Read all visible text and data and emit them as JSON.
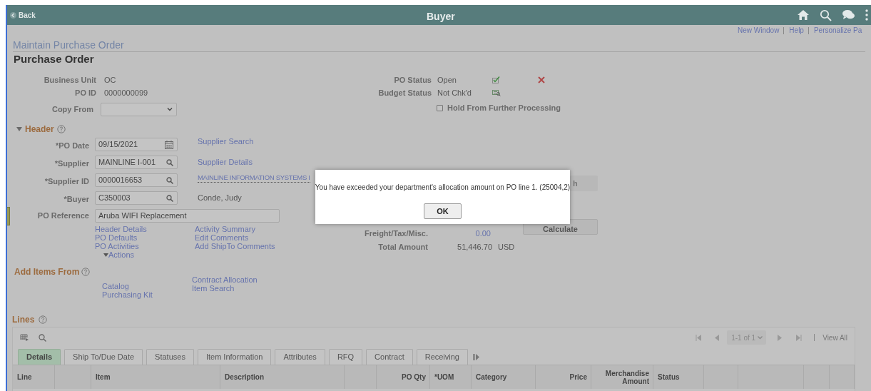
{
  "topbar": {
    "back": "Back",
    "title": "Buyer"
  },
  "utility_links": [
    "New Window",
    "Help",
    "Personalize Pa"
  ],
  "page_title": "Maintain Purchase Order",
  "section_title": "Purchase Order",
  "summary_left": [
    {
      "label": "Business Unit",
      "value": "OC"
    },
    {
      "label": "PO ID",
      "value": "0000000099"
    }
  ],
  "copy_from": {
    "label": "Copy From"
  },
  "summary_right": [
    {
      "label": "PO Status",
      "value": "Open",
      "kind": "status"
    },
    {
      "label": "Budget Status",
      "value": "Not Chk'd",
      "kind": "budget"
    }
  ],
  "hold": {
    "label": "Hold From Further Processing",
    "checked": false
  },
  "header": {
    "title": "Header",
    "expanded": true,
    "fields": [
      {
        "label": "*PO Date",
        "value": "09/15/2021",
        "kind": "date",
        "link": "Supplier Search"
      },
      {
        "label": "*Supplier",
        "value": "MAINLINE I-001",
        "kind": "lookup",
        "link": "Supplier Details"
      },
      {
        "label": "*Supplier ID",
        "value": "0000016653",
        "kind": "lookup",
        "link": "MAINLINE INFORMATION SYSTEMS I"
      },
      {
        "label": "*Buyer",
        "value": "C350003",
        "kind": "lookup",
        "note": "Conde, Judy"
      },
      {
        "label": "PO Reference",
        "value": "Aruba WIFI Replacement",
        "kind": "text"
      }
    ],
    "links_col1": [
      "Header Details",
      "PO Defaults",
      "PO Activities"
    ],
    "actions": "Actions",
    "links_col2": [
      "Activity Summary",
      "Edit Comments",
      "Add ShipTo Comments"
    ]
  },
  "partial_button": "h",
  "calculate": "Calculate",
  "totals": [
    {
      "label": "Freight/Tax/Misc.",
      "value": "0.00",
      "kind": "link"
    },
    {
      "label": "Total Amount",
      "value": "51,446.70",
      "currency": "USD",
      "kind": "plain"
    }
  ],
  "add_items": {
    "title": "Add Items From",
    "col1": [
      "Catalog",
      "Purchasing Kit"
    ],
    "col2": [
      "Contract Allocation",
      "Item Search"
    ]
  },
  "lines": {
    "title": "Lines",
    "pager": "1-1 of 1",
    "view_all": "View All",
    "tabs": [
      {
        "label": "Details",
        "selected": true
      },
      {
        "label": "Ship To/Due Date",
        "selected": false
      },
      {
        "label": "Statuses",
        "selected": false
      },
      {
        "label": "Item Information",
        "selected": false
      },
      {
        "label": "Attributes",
        "selected": false
      },
      {
        "label": "RFQ",
        "selected": false
      },
      {
        "label": "Contract",
        "selected": false
      },
      {
        "label": "Receiving",
        "selected": false
      }
    ],
    "columns": [
      {
        "kind": "text",
        "label": "Line"
      },
      {
        "kind": "blank"
      },
      {
        "kind": "text",
        "label": "Item"
      },
      {
        "kind": "text",
        "label": "Description"
      },
      {
        "kind": "blank"
      },
      {
        "kind": "number",
        "label": "PO Qty"
      },
      {
        "kind": "text",
        "label": "*UOM"
      },
      {
        "kind": "text",
        "label": "Category"
      },
      {
        "kind": "number",
        "label": "Price"
      },
      {
        "kind": "number",
        "label": "Merchandise Amount"
      },
      {
        "kind": "text",
        "label": "Status"
      },
      {
        "kind": "blank"
      },
      {
        "kind": "blank"
      },
      {
        "kind": "blank"
      },
      {
        "kind": "blank"
      }
    ]
  },
  "dialog": {
    "message": "You have exceeded your department's allocation amount on PO line 1. (25004,2)",
    "button": "OK"
  }
}
